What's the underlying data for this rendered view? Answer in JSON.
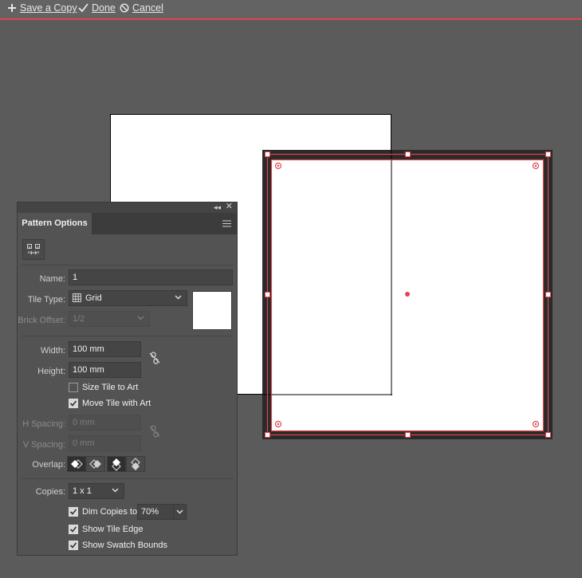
{
  "topbar": {
    "save_copy": "Save a Copy",
    "done": "Done",
    "cancel": "Cancel"
  },
  "colors": {
    "accent": "#e0474c",
    "panel": "#535353",
    "canvas": "#5b5b5b"
  },
  "panel": {
    "tab_label": "Pattern Options",
    "name_label": "Name:",
    "name_value": "1",
    "tile_type_label": "Tile Type:",
    "tile_type_value": "Grid",
    "brick_offset_label": "Brick Offset:",
    "brick_offset_value": "1/2",
    "width_label": "Width:",
    "width_value": "100 mm",
    "height_label": "Height:",
    "height_value": "100 mm",
    "size_tile_to_art": "Size Tile to Art",
    "move_tile_with_art": "Move Tile with Art",
    "h_spacing_label": "H Spacing:",
    "h_spacing_value": "0 mm",
    "v_spacing_label": "V Spacing:",
    "v_spacing_value": "0 mm",
    "overlap_label": "Overlap:",
    "copies_label": "Copies:",
    "copies_value": "1 x 1",
    "dim_copies_label": "Dim Copies to:",
    "dim_copies_value": "70%",
    "show_tile_edge": "Show Tile Edge",
    "show_swatch_bounds": "Show Swatch Bounds"
  }
}
